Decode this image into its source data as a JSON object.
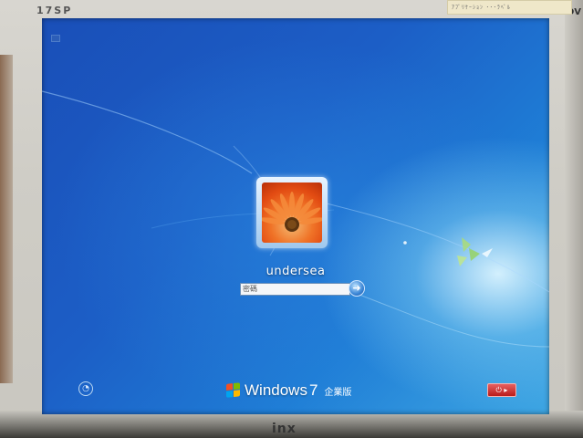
{
  "monitor": {
    "model_label": "17SP",
    "corner_label": "DV",
    "brand_label": "inx",
    "sticker_text": "ｱﾌﾞﾘｹｰｼｮﾝ ･･･ﾗﾍﾞﾙ"
  },
  "login": {
    "username": "undersea",
    "password_placeholder": "密碼",
    "submit_icon": "arrow-right-icon",
    "avatar_icon": "gerbera-flower-picture"
  },
  "branding": {
    "windows_text": "Windows",
    "version": "7",
    "edition": "企業版"
  },
  "controls": {
    "ease_of_access_icon": "ease-of-access-icon",
    "shutdown_icon": "power-icon",
    "shutdown_arrow": "▸"
  },
  "colors": {
    "accent": "#1f6fd0",
    "shutdown_red": "#c62828"
  }
}
